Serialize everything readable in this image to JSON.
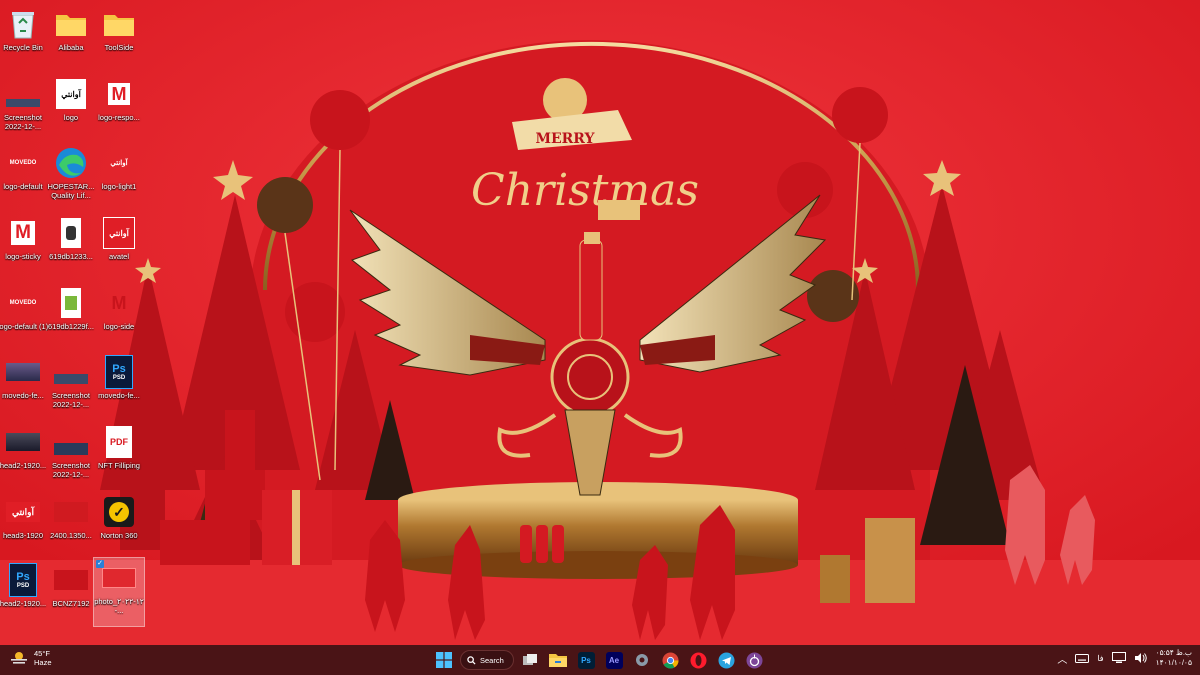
{
  "wallpaper": {
    "greeting_top": "MERRY",
    "greeting_main": "Christmas",
    "colors": {
      "background": "#e01e26",
      "gold": "#e8c27a",
      "dark_red": "#a8101a"
    }
  },
  "desktop": {
    "icons": [
      {
        "label": "Recycle Bin",
        "icon": "recycle-bin-icon"
      },
      {
        "label": "Alibaba",
        "icon": "folder-icon"
      },
      {
        "label": "ToolSide",
        "icon": "folder-icon"
      },
      {
        "label": "Screenshot 2022-12-...",
        "icon": "image-thumbnail-icon"
      },
      {
        "label": "logo",
        "icon": "image-thumbnail-icon",
        "caption": "آوانتي"
      },
      {
        "label": "logo-respo...",
        "icon": "m-logo-icon"
      },
      {
        "label": "logo-default",
        "icon": "movedo-logo-icon",
        "caption": "MOVEDO"
      },
      {
        "label": "HOPESTAR... Quality Lif...",
        "icon": "edge-icon"
      },
      {
        "label": "logo-light1",
        "icon": "image-thumbnail-icon",
        "caption": "آوانتي"
      },
      {
        "label": "logo-sticky",
        "icon": "m-logo-icon"
      },
      {
        "label": "619db1233...",
        "icon": "image-thumbnail-icon"
      },
      {
        "label": "avatel",
        "icon": "image-thumbnail-icon",
        "caption": "آوانتي"
      },
      {
        "label": "logo-default (1)",
        "icon": "movedo-logo-icon",
        "caption": "MOVEDO"
      },
      {
        "label": "619db1229f...",
        "icon": "image-thumbnail-icon"
      },
      {
        "label": "logo-side",
        "icon": "m-logo-icon"
      },
      {
        "label": "movedo-fe...",
        "icon": "image-thumbnail-icon"
      },
      {
        "label": "Screenshot 2022-12-...",
        "icon": "image-thumbnail-icon"
      },
      {
        "label": "movedo-fe...",
        "icon": "psd-icon",
        "caption": "PSD"
      },
      {
        "label": "head2-1920...",
        "icon": "image-thumbnail-icon"
      },
      {
        "label": "Screenshot 2022-12-...",
        "icon": "image-thumbnail-icon"
      },
      {
        "label": "NFT Filliping",
        "icon": "pdf-icon",
        "caption": "PDF"
      },
      {
        "label": "head3-1920",
        "icon": "image-thumbnail-icon",
        "caption": "آوانتي"
      },
      {
        "label": "2400.1350...",
        "icon": "image-thumbnail-icon"
      },
      {
        "label": "Norton 360",
        "icon": "norton-icon"
      },
      {
        "label": "head2-1920...",
        "icon": "psd-icon",
        "caption": "PSD"
      },
      {
        "label": "BCNZ7192",
        "icon": "image-thumbnail-icon"
      },
      {
        "label": "photo_۲۰۲۲-۱۲-...",
        "icon": "image-thumbnail-icon",
        "selected": true
      }
    ]
  },
  "taskbar": {
    "weather": {
      "temp": "45°F",
      "condition": "Haze",
      "icon": "weather-haze-icon"
    },
    "search_label": "Search",
    "apps": [
      {
        "name": "start-button",
        "icon": "windows-logo-icon"
      },
      {
        "name": "taskbar-task-view",
        "icon": "task-view-icon"
      },
      {
        "name": "taskbar-file-explorer",
        "icon": "file-explorer-icon"
      },
      {
        "name": "taskbar-photoshop",
        "icon": "photoshop-icon",
        "text": "Ps"
      },
      {
        "name": "taskbar-after-effects",
        "icon": "after-effects-icon",
        "text": "Ae"
      },
      {
        "name": "taskbar-settings",
        "icon": "settings-gear-icon"
      },
      {
        "name": "taskbar-chrome",
        "icon": "chrome-icon"
      },
      {
        "name": "taskbar-opera",
        "icon": "opera-icon"
      },
      {
        "name": "taskbar-telegram",
        "icon": "telegram-icon"
      },
      {
        "name": "taskbar-tor",
        "icon": "tor-icon"
      }
    ],
    "tray": {
      "lang": "فا",
      "time": "ب.ظ ۰۵:۵۴",
      "date": "۱۴۰۱/۱۰/۰۵"
    }
  }
}
